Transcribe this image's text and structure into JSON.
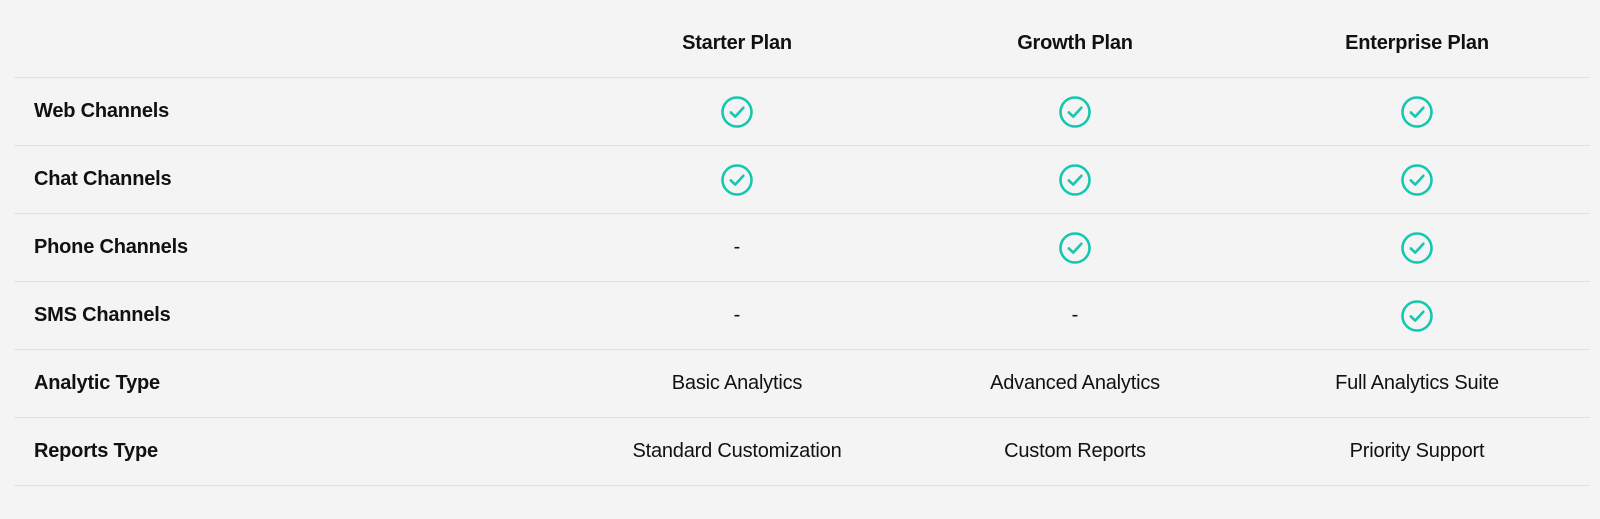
{
  "accent_color": "#14c8b0",
  "plans": [
    {
      "name": "Starter Plan"
    },
    {
      "name": "Growth Plan"
    },
    {
      "name": "Enterprise Plan"
    }
  ],
  "features": [
    {
      "label": "Web Channels",
      "values": [
        {
          "type": "check-icon"
        },
        {
          "type": "check-icon"
        },
        {
          "type": "check-icon"
        }
      ]
    },
    {
      "label": "Chat Channels",
      "values": [
        {
          "type": "check-icon"
        },
        {
          "type": "check-icon"
        },
        {
          "type": "check-icon"
        }
      ]
    },
    {
      "label": "Phone Channels",
      "values": [
        {
          "type": "text",
          "text": "-"
        },
        {
          "type": "check-icon"
        },
        {
          "type": "check-icon"
        }
      ]
    },
    {
      "label": "SMS Channels",
      "values": [
        {
          "type": "text",
          "text": "-"
        },
        {
          "type": "text",
          "text": "-"
        },
        {
          "type": "check-icon"
        }
      ]
    },
    {
      "label": "Analytic Type",
      "values": [
        {
          "type": "text",
          "text": "Basic Analytics"
        },
        {
          "type": "text",
          "text": "Advanced Analytics"
        },
        {
          "type": "text",
          "text": "Full Analytics Suite"
        }
      ]
    },
    {
      "label": "Reports Type",
      "values": [
        {
          "type": "text",
          "text": "Standard Customization"
        },
        {
          "type": "text",
          "text": "Custom Reports"
        },
        {
          "type": "text",
          "text": "Priority Support"
        }
      ]
    }
  ]
}
